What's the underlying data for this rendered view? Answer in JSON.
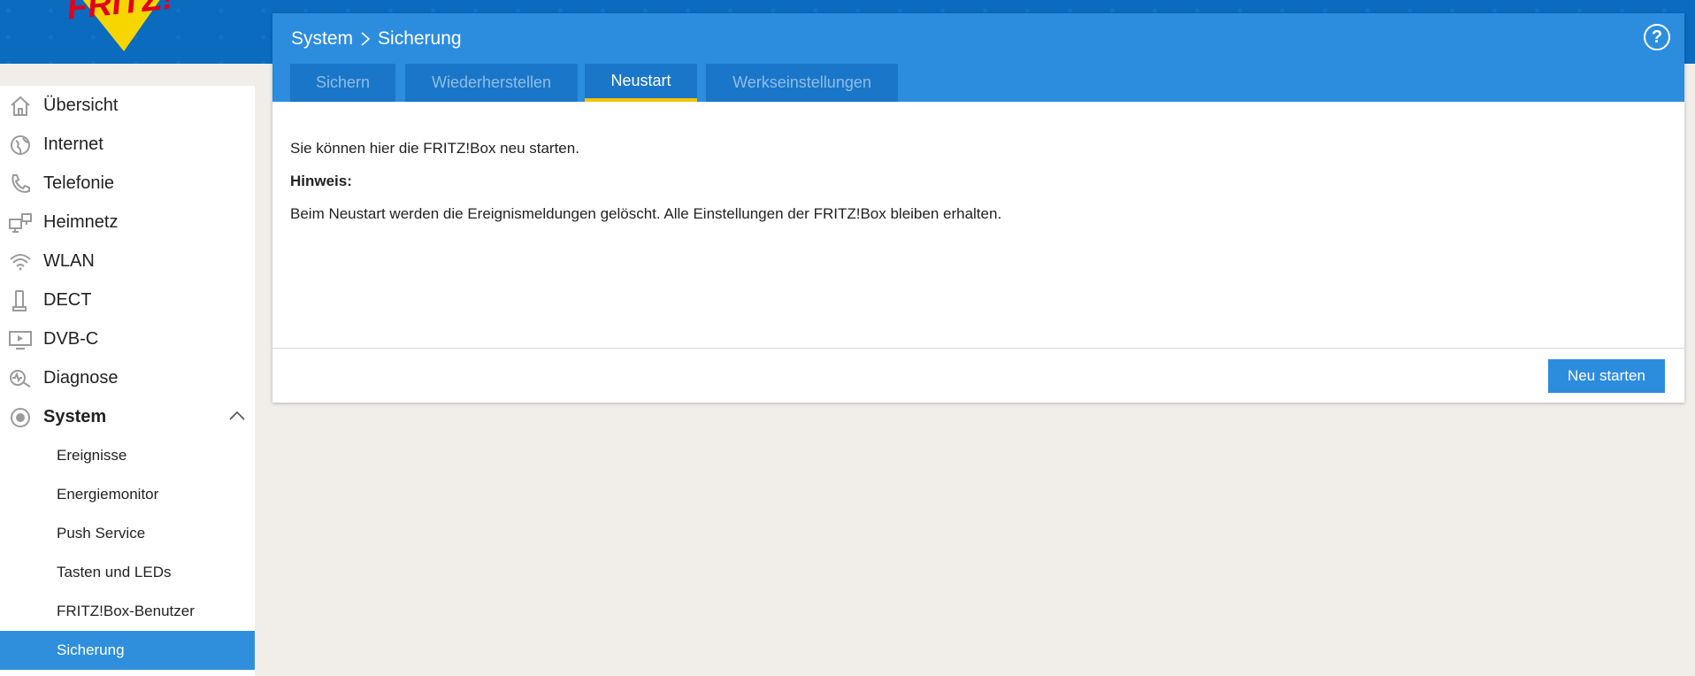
{
  "brand": {
    "logo_text": "FRITZ!"
  },
  "sidebar": {
    "items": [
      {
        "label": "Übersicht",
        "icon": "home-icon"
      },
      {
        "label": "Internet",
        "icon": "globe-icon"
      },
      {
        "label": "Telefonie",
        "icon": "phone-icon"
      },
      {
        "label": "Heimnetz",
        "icon": "network-icon"
      },
      {
        "label": "WLAN",
        "icon": "wifi-icon"
      },
      {
        "label": "DECT",
        "icon": "dect-phone-icon"
      },
      {
        "label": "DVB-C",
        "icon": "tv-icon"
      },
      {
        "label": "Diagnose",
        "icon": "diagnose-icon"
      },
      {
        "label": "System",
        "icon": "system-icon",
        "expanded": true
      }
    ],
    "sub_items": [
      {
        "label": "Ereignisse"
      },
      {
        "label": "Energiemonitor"
      },
      {
        "label": "Push Service"
      },
      {
        "label": "Tasten und LEDs"
      },
      {
        "label": "FRITZ!Box-Benutzer"
      },
      {
        "label": "Sicherung",
        "selected": true
      }
    ]
  },
  "header": {
    "breadcrumb": [
      "System",
      "Sicherung"
    ],
    "help": "?"
  },
  "tabs": [
    {
      "label": "Sichern"
    },
    {
      "label": "Wiederherstellen"
    },
    {
      "label": "Neustart",
      "active": true
    },
    {
      "label": "Werkseinstellungen"
    }
  ],
  "content": {
    "intro": "Sie können hier die FRITZ!Box neu starten.",
    "hint_title": "Hinweis:",
    "hint_text": "Beim Neustart werden die Ereignismeldungen gelöscht. Alle Einstellungen der FRITZ!Box bleiben erhalten."
  },
  "actions": {
    "restart_label": "Neu starten"
  },
  "colors": {
    "topbar": "#0a6bbf",
    "panel_header": "#2c8ddf",
    "tab_bg": "#1a76c8",
    "tab_active_underline": "#f5c400",
    "selected_nav": "#2f8fdd",
    "page_bg": "#f1eeea"
  }
}
